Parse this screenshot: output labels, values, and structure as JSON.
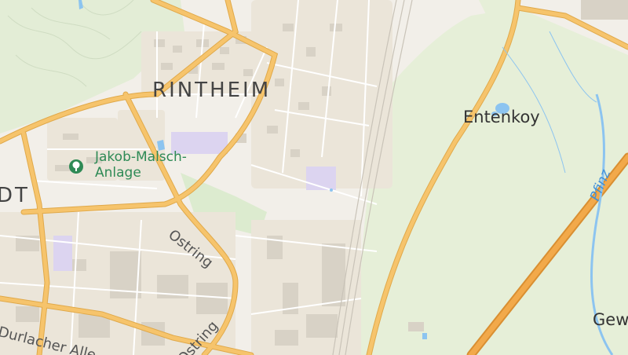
{
  "labels": {
    "district": "RINTHEIM",
    "district_cut": "DT",
    "place": "Entenkoy",
    "place_cut": "Gew",
    "park_line1": "Jakob-Malsch-",
    "park_line2": "Anlage",
    "street_ostring": "Ostring",
    "street_ostring2": "Ostring",
    "street_durlacher": "Durlacher Alle",
    "river": "Pfinz"
  },
  "icons": {
    "park": "tree-icon"
  },
  "colors": {
    "land": "#f2efe9",
    "forest": "#e6efd8",
    "park": "#d6eacb",
    "road_major": "#f6c46c",
    "road_minor": "#ffffff",
    "building": "#dcd7ce",
    "special": "#dcd4f0",
    "water": "#8cc4f0"
  }
}
